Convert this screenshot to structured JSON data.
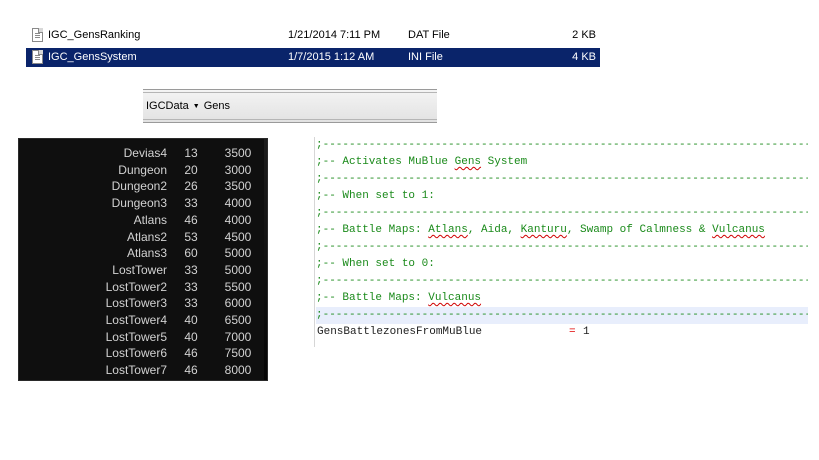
{
  "files": [
    {
      "name": "IGC_GensRanking",
      "date": "1/21/2014 7:11 PM",
      "type": "DAT File",
      "size": "2 KB",
      "selected": false,
      "icon": "document-icon"
    },
    {
      "name": "IGC_GensSystem",
      "date": "1/7/2015 1:12 AM",
      "type": "INI File",
      "size": "4 KB",
      "selected": true,
      "icon": "document-icon"
    }
  ],
  "breadcrumb": {
    "items": [
      "IGCData",
      "Gens"
    ],
    "separator_icon": "triangle-down-icon"
  },
  "maps": [
    {
      "name": "Devias4",
      "level": "13",
      "value": "3500"
    },
    {
      "name": "Dungeon",
      "level": "20",
      "value": "3000"
    },
    {
      "name": "Dungeon2",
      "level": "26",
      "value": "3500"
    },
    {
      "name": "Dungeon3",
      "level": "33",
      "value": "4000"
    },
    {
      "name": "Atlans",
      "level": "46",
      "value": "4000"
    },
    {
      "name": "Atlans2",
      "level": "53",
      "value": "4500"
    },
    {
      "name": "Atlans3",
      "level": "60",
      "value": "5000"
    },
    {
      "name": "LostTower",
      "level": "33",
      "value": "5000"
    },
    {
      "name": "LostTower2",
      "level": "33",
      "value": "5500"
    },
    {
      "name": "LostTower3",
      "level": "33",
      "value": "6000"
    },
    {
      "name": "LostTower4",
      "level": "40",
      "value": "6500"
    },
    {
      "name": "LostTower5",
      "level": "40",
      "value": "7000"
    },
    {
      "name": "LostTower6",
      "level": "46",
      "value": "7500"
    },
    {
      "name": "LostTower7",
      "level": "46",
      "value": "8000"
    }
  ],
  "editor": {
    "divider": ";-----------------------------------------------------------------------------------",
    "lines": [
      {
        "kind": "div"
      },
      {
        "kind": "comment",
        "parts": [
          {
            "t": ";-- Activates MuBlue "
          },
          {
            "t": "Gens",
            "sq": true
          },
          {
            "t": " System"
          }
        ]
      },
      {
        "kind": "div"
      },
      {
        "kind": "comment",
        "parts": [
          {
            "t": ";-- When set to 1:"
          }
        ]
      },
      {
        "kind": "div"
      },
      {
        "kind": "comment",
        "parts": [
          {
            "t": ";-- Battle Maps: "
          },
          {
            "t": "Atlans",
            "sq": true
          },
          {
            "t": ", Aida, "
          },
          {
            "t": "Kanturu",
            "sq": true
          },
          {
            "t": ", Swamp of Calmness & "
          },
          {
            "t": "Vulcanus",
            "sq": true
          }
        ]
      },
      {
        "kind": "div"
      },
      {
        "kind": "comment",
        "parts": [
          {
            "t": ";-- When set to 0:"
          }
        ]
      },
      {
        "kind": "div"
      },
      {
        "kind": "comment",
        "parts": [
          {
            "t": ";-- Battle Maps: "
          },
          {
            "t": "Vulcanus",
            "sq": true
          }
        ]
      },
      {
        "kind": "div",
        "highlight": true
      },
      {
        "kind": "keyvalue",
        "key": "GensBattlezonesFromMuBlue",
        "eq": "=",
        "value": "1"
      }
    ]
  },
  "colors": {
    "selection": "#0a246a",
    "comment": "#1a8a1a",
    "equals": "#e00000",
    "table_bg": "#0f0f0f"
  }
}
